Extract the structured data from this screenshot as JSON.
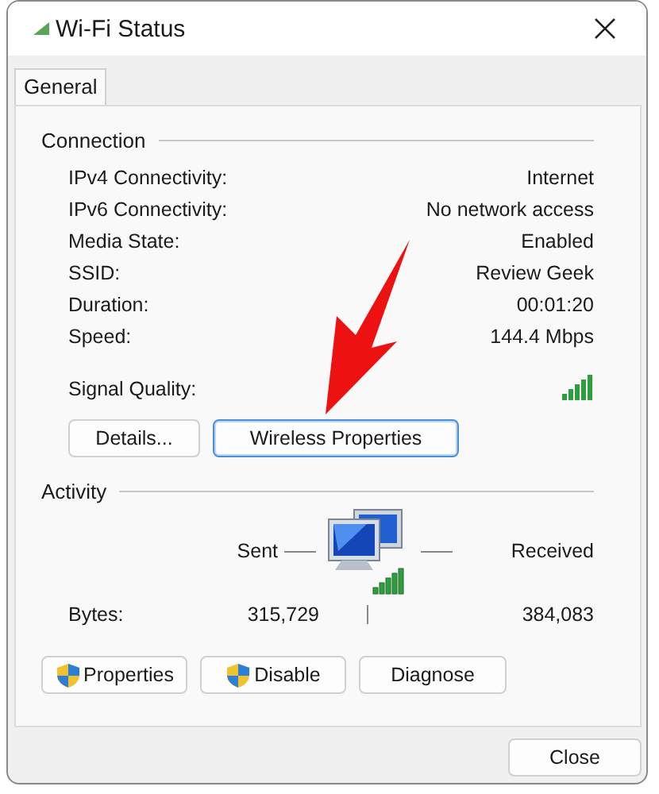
{
  "window": {
    "title": "Wi-Fi Status"
  },
  "tabs": [
    {
      "label": "General",
      "selected": true
    }
  ],
  "connection": {
    "heading": "Connection",
    "rows": [
      {
        "label": "IPv4 Connectivity:",
        "value": "Internet"
      },
      {
        "label": "IPv6 Connectivity:",
        "value": "No network access"
      },
      {
        "label": "Media State:",
        "value": "Enabled"
      },
      {
        "label": "SSID:",
        "value": "Review Geek"
      },
      {
        "label": "Duration:",
        "value": "00:01:20"
      },
      {
        "label": "Speed:",
        "value": "144.4 Mbps"
      }
    ],
    "signal_label": "Signal Quality:"
  },
  "connection_buttons": [
    {
      "label": "Details...",
      "focused": false
    },
    {
      "label": "Wireless Properties",
      "focused": true
    }
  ],
  "activity": {
    "heading": "Activity",
    "sent_label": "Sent",
    "received_label": "Received",
    "bytes_label": "Bytes:",
    "sent": "315,729",
    "received": "384,083"
  },
  "actions": [
    {
      "label": "Properties",
      "shield": true
    },
    {
      "label": "Disable",
      "shield": true
    },
    {
      "label": "Diagnose",
      "shield": false
    }
  ],
  "close_button": {
    "label": "Close"
  },
  "annotation": {
    "kind": "arrow"
  }
}
